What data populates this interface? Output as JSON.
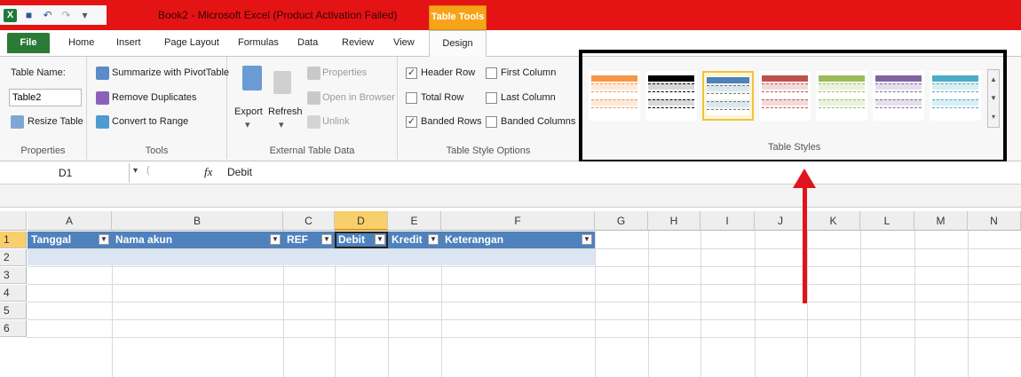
{
  "window": {
    "title": "Book2 - Microsoft Excel (Product Activation Failed)",
    "context_tab_group": "Table Tools"
  },
  "tabs": [
    "File",
    "Home",
    "Insert",
    "Page Layout",
    "Formulas",
    "Data",
    "Review",
    "View",
    "Design"
  ],
  "ribbon": {
    "properties": {
      "label": "Properties",
      "table_name_label": "Table Name:",
      "table_name_value": "Table2",
      "resize_label": "Resize Table"
    },
    "tools": {
      "label": "Tools",
      "summarize": "Summarize with PivotTable",
      "remove_duplicates": "Remove Duplicates",
      "convert": "Convert to Range"
    },
    "external": {
      "label": "External Table Data",
      "export": "Export",
      "refresh": "Refresh",
      "properties": "Properties",
      "open_browser": "Open in Browser",
      "unlink": "Unlink"
    },
    "style_options": {
      "label": "Table Style Options",
      "header_row": {
        "text": "Header Row",
        "checked": "✓"
      },
      "total_row": {
        "text": "Total Row",
        "checked": ""
      },
      "banded_rows": {
        "text": "Banded Rows",
        "checked": "✓"
      },
      "first_column": {
        "text": "First Column",
        "checked": ""
      },
      "last_column": {
        "text": "Last Column",
        "checked": ""
      },
      "banded_columns": {
        "text": "Banded Columns",
        "checked": ""
      }
    },
    "table_styles": {
      "label": "Table Styles",
      "swatches": [
        {
          "accent": "#f79646",
          "band": "#fde9d9"
        },
        {
          "accent": "#000000",
          "band": "#d9d9d9"
        },
        {
          "accent": "#4f81bd",
          "band": "#dce6f2",
          "selected": true
        },
        {
          "accent": "#c0504d",
          "band": "#f2dcdb"
        },
        {
          "accent": "#9bbb59",
          "band": "#ebf1de"
        },
        {
          "accent": "#8064a2",
          "band": "#e5e0ec"
        },
        {
          "accent": "#4bacc6",
          "band": "#daeef3"
        }
      ]
    }
  },
  "formula_bar": {
    "name_box": "D1",
    "fx": "fx",
    "value": "Debit"
  },
  "grid": {
    "columns": [
      "A",
      "B",
      "C",
      "D",
      "E",
      "F",
      "G",
      "H",
      "I",
      "J",
      "K",
      "L",
      "M",
      "N"
    ],
    "rows": [
      "1",
      "2",
      "3",
      "4",
      "5",
      "6"
    ],
    "active_column": "D",
    "active_row": "1",
    "table_headers": [
      "Tanggal",
      "Nama akun",
      "REF",
      "Debit",
      "Kredit",
      "Keterangan"
    ]
  },
  "colors": {
    "title_bar": "#e41414",
    "table_header": "#4f81bd",
    "table_band": "#dce6f2",
    "file_tab": "#2b7a36",
    "annotation_arrow": "#e0141e"
  }
}
